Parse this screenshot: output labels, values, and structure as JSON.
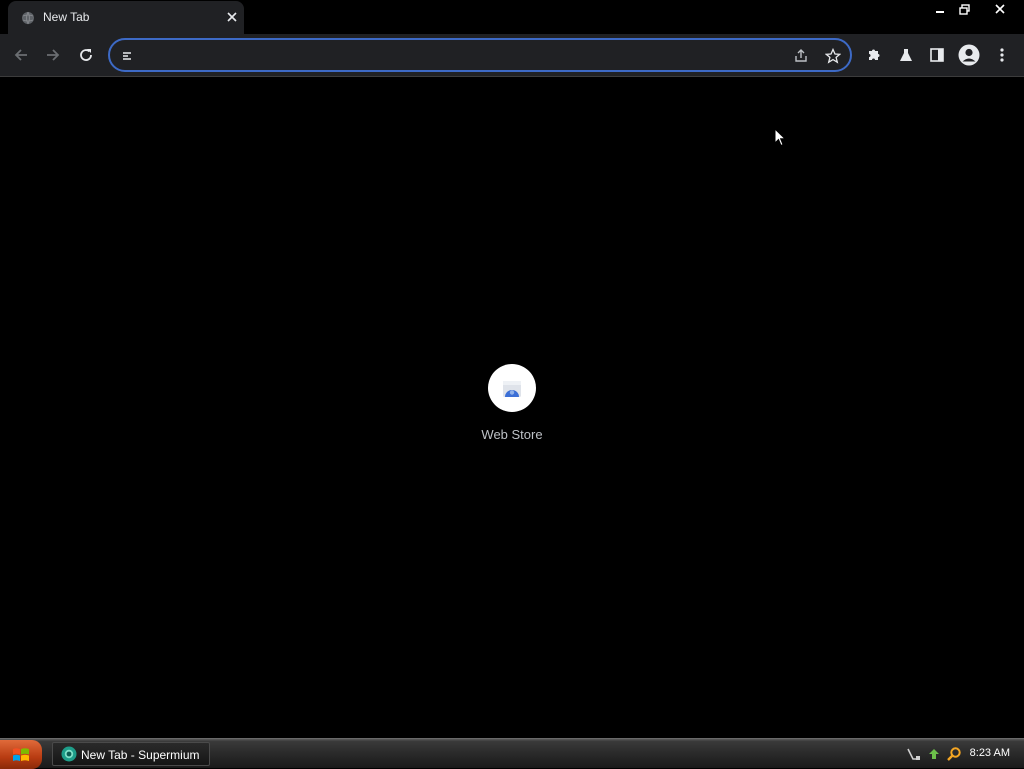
{
  "browser": {
    "tab": {
      "title": "New Tab",
      "favicon": "globe-icon"
    },
    "caption": {
      "minimize": "minimize-icon",
      "restore": "restore-icon",
      "close": "close-icon"
    },
    "toolbar": {
      "back": "back-arrow-icon",
      "forward": "forward-arrow-icon",
      "reload": "reload-icon",
      "omnibox": {
        "value": "",
        "placeholder": ""
      },
      "share": "share-icon",
      "bookmark": "star-icon",
      "extensions": "puzzle-icon",
      "labs": "flask-icon",
      "side_panel": "side-panel-icon",
      "profile": "profile-avatar-icon",
      "menu": "kebab-menu-icon"
    },
    "accent_color": "#3d6ac6"
  },
  "new_tab": {
    "shortcuts": [
      {
        "label": "Web Store",
        "icon": "web-store-icon"
      }
    ]
  },
  "taskbar": {
    "start": "start-button",
    "items": [
      {
        "label": "New Tab - Supermium",
        "icon": "supermium-icon"
      }
    ],
    "tray_icons": [
      "network-icon",
      "update-icon",
      "search-icon"
    ],
    "clock": "8:23 AM"
  }
}
